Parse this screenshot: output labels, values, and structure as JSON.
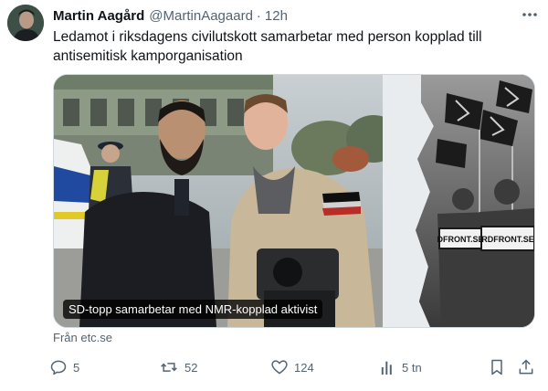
{
  "tweet": {
    "display_name": "Martin Aagård",
    "handle": "@MartinAagaard",
    "separator": "·",
    "time": "12h",
    "text": "Ledamot i riksdagens civilutskott samarbetar med person kopplad till antisemitisk kamporganisation"
  },
  "card": {
    "caption": "SD-topp samarbetar med NMR-kopplad aktivist",
    "sign_left": "DFRONT.SE",
    "sign_right": "RDFRONT.SE",
    "source": "Från etc.se"
  },
  "actions": {
    "replies": "5",
    "reposts": "52",
    "likes": "124",
    "views": "5 tn"
  },
  "colors": {
    "text": "#0f1419",
    "muted": "#536471",
    "border": "#cfd9de"
  },
  "icons": [
    "more-icon",
    "reply-icon",
    "repost-icon",
    "like-icon",
    "views-icon",
    "bookmark-icon",
    "share-icon"
  ]
}
